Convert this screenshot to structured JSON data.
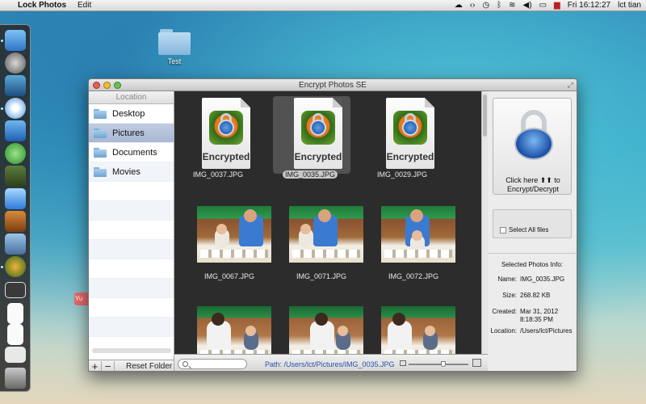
{
  "menubar": {
    "apple": "",
    "app_name": "Lock Photos",
    "menus": [
      "Edit"
    ],
    "clock": "Fri 16:12:27",
    "user": "lct tian"
  },
  "desktop": {
    "folder_label": "Test",
    "side_tag": "Yu"
  },
  "window": {
    "title": "Encrypt Photos SE"
  },
  "sidebar": {
    "header": "Location",
    "items": [
      {
        "label": "Desktop"
      },
      {
        "label": "Pictures"
      },
      {
        "label": "Documents"
      },
      {
        "label": "Movies"
      }
    ],
    "add": "+",
    "remove": "−",
    "reset": "Reset Folder"
  },
  "grid": {
    "items": [
      {
        "label": "IMG_0037.JPG",
        "badge": "Encrypted"
      },
      {
        "label": "IMG_0035.JPG",
        "badge": "Encrypted"
      },
      {
        "label": "IMG_0029.JPG",
        "badge": "Encrypted"
      },
      {
        "label": "IMG_0067.JPG"
      },
      {
        "label": "IMG_0071.JPG"
      },
      {
        "label": "IMG_0072.JPG"
      }
    ]
  },
  "bottombar": {
    "path": "Path:  /Users/lct/Pictures/IMG_0035.JPG"
  },
  "rpanel": {
    "encrypt_caption_1": "Click here ⬆⬆ to",
    "encrypt_caption_2": "Encrypt/Decrypt",
    "select_all": "Select All files",
    "info_title": "Selected Photos Info:",
    "info": {
      "name_k": "Name:",
      "name_v": "IMG_0035.JPG",
      "size_k": "Size:",
      "size_v": "268.82 KB",
      "created_k": "Created:",
      "created_v1": "Mar 31, 2012",
      "created_v2": "8:18:35 PM",
      "location_k": "Location:",
      "location_v": "/Users/lct/Pictures"
    }
  }
}
